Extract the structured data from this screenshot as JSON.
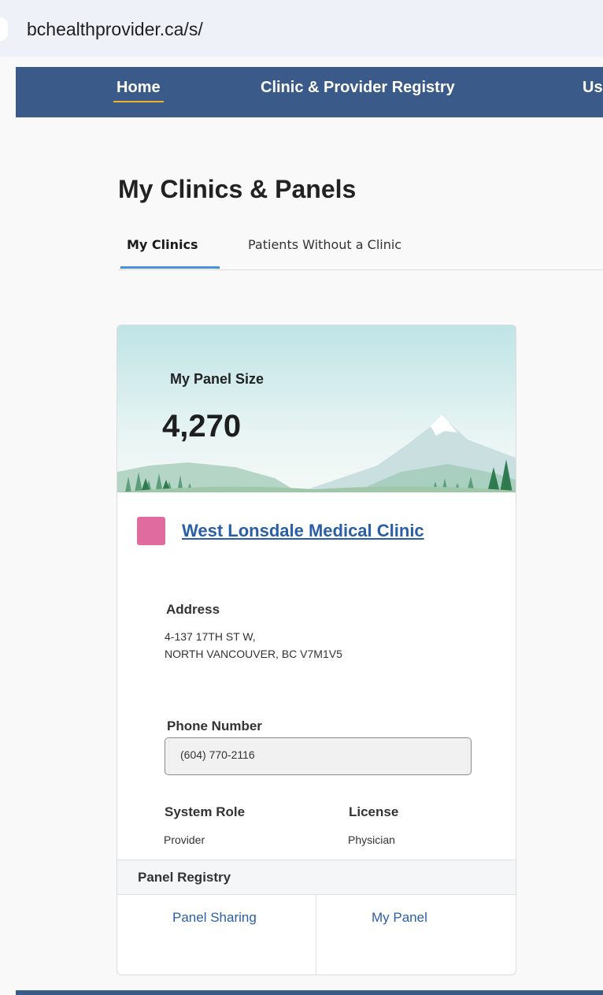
{
  "browser": {
    "url": "bchealthprovider.ca/s/"
  },
  "nav": {
    "items": [
      {
        "label": "Home",
        "active": true
      },
      {
        "label": "Clinic & Provider Registry",
        "active": false
      },
      {
        "label": "Us",
        "active": false
      }
    ],
    "background": "#3a5a8a",
    "active_underline": "#f0b323"
  },
  "page": {
    "title": "My Clinics & Panels"
  },
  "tabs": [
    {
      "label": "My Clinics",
      "active": true
    },
    {
      "label": "Patients Without a Clinic",
      "active": false
    }
  ],
  "card": {
    "panel_size_label": "My Panel Size",
    "panel_size_value": "4,270",
    "clinic_name": "West Lonsdale Medical Clinic",
    "clinic_color": "#e06c9f",
    "address_label": "Address",
    "address_line1": "4-137 17TH ST W,",
    "address_line2": "NORTH VANCOUVER, BC V7M1V5",
    "phone_label": "Phone Number",
    "phone_value": "(604) 770-2116",
    "system_role_label": "System Role",
    "system_role_value": "Provider",
    "license_label": "License",
    "license_value": "Physician",
    "registry_header": "Panel Registry",
    "actions": [
      "Panel Sharing",
      "My Panel"
    ]
  }
}
